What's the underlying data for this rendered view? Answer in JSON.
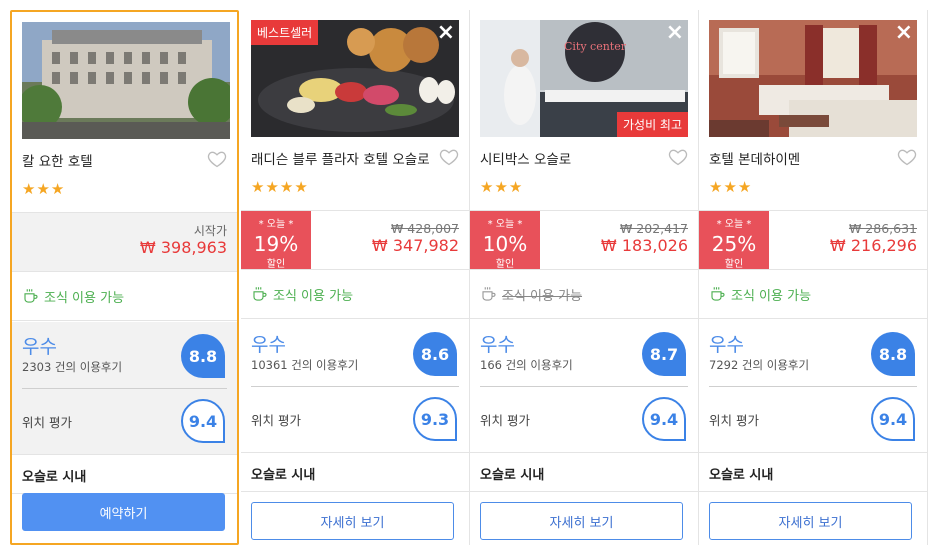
{
  "hotels": [
    {
      "name": "칼 요한 호텔",
      "stars": "★★★",
      "from_label": "시작가",
      "price": "₩ 398,963",
      "breakfast": "조식 이용 가능",
      "rating_word": "우수",
      "review_count": "2303 건의 이용후기",
      "score": "8.8",
      "location_label": "위치 평가",
      "location_score": "9.4",
      "area": "오슬로 시내",
      "button": "예약하기"
    },
    {
      "name": "래디슨 블루 플라자 호텔 오슬로",
      "badge_top": "베스트셀러",
      "stars": "★★★★",
      "discount_today": "* 오늘 *",
      "discount_pct": "19%",
      "discount_off": "할인",
      "old_price": "₩ 428,007",
      "price": "₩ 347,982",
      "breakfast": "조식 이용 가능",
      "rating_word": "우수",
      "review_count": "10361 건의 이용후기",
      "score": "8.6",
      "location_label": "위치 평가",
      "location_score": "9.3",
      "area": "오슬로 시내",
      "button": "자세히 보기"
    },
    {
      "name": "시티박스 오슬로",
      "badge_bottom": "가성비 최고",
      "photo_sign": "City center",
      "stars": "★★★",
      "discount_today": "* 오늘 *",
      "discount_pct": "10%",
      "discount_off": "할인",
      "old_price": "₩ 202,417",
      "price": "₩ 183,026",
      "breakfast": "조식 이용 가능",
      "rating_word": "우수",
      "review_count": "166 건의 이용후기",
      "score": "8.7",
      "location_label": "위치 평가",
      "location_score": "9.4",
      "area": "오슬로 시내",
      "button": "자세히 보기"
    },
    {
      "name": "호텔 본데하이멘",
      "stars": "★★★",
      "discount_today": "* 오늘 *",
      "discount_pct": "25%",
      "discount_off": "할인",
      "old_price": "₩ 286,631",
      "price": "₩ 216,296",
      "breakfast": "조식 이용 가능",
      "rating_word": "우수",
      "review_count": "7292 건의 이용후기",
      "score": "8.8",
      "location_label": "위치 평가",
      "location_score": "9.4",
      "area": "오슬로 시내",
      "button": "자세히 보기"
    }
  ],
  "colors": {
    "accent_blue": "#3b82e6",
    "discount_red": "#e8515a",
    "price_red": "#e83a3a",
    "selected_border": "#f5a623",
    "breakfast_green": "#4caf50"
  },
  "icons": {
    "close": "close-icon",
    "favorite": "heart-icon",
    "breakfast": "coffee-cup-icon"
  }
}
